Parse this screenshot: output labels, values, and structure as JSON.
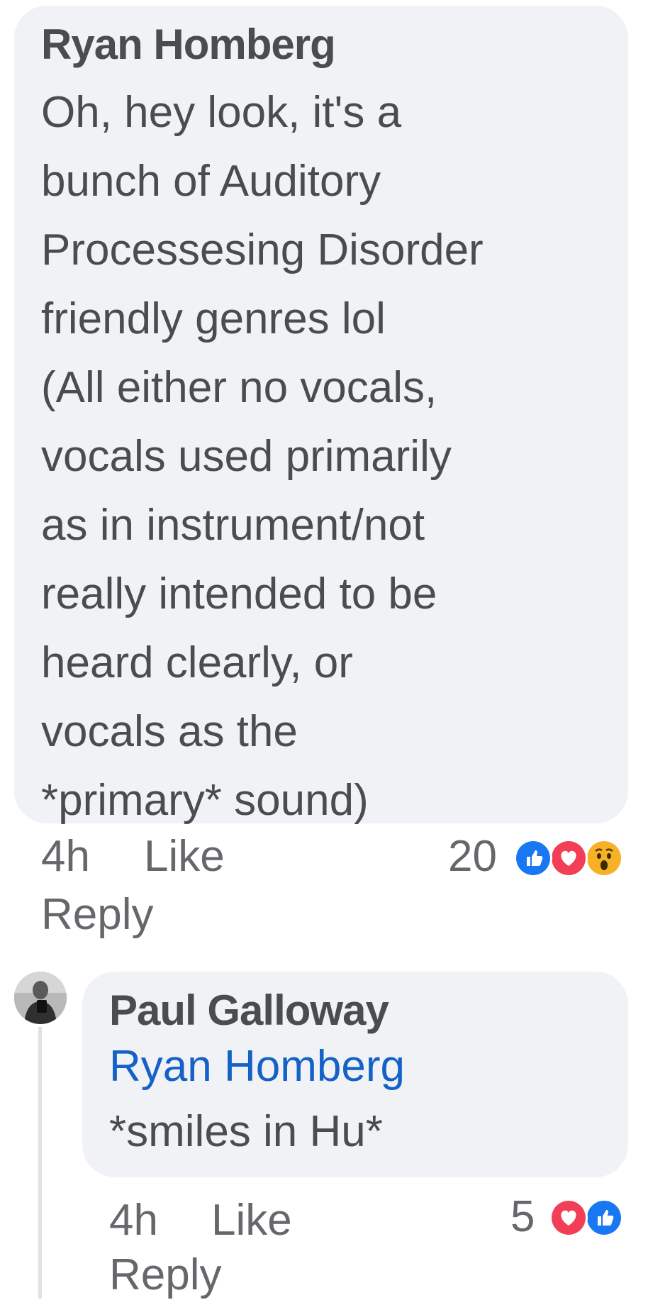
{
  "main_comment": {
    "author": "Ryan Homberg",
    "text": "Oh, hey look, it's a\nbunch of Auditory\nProcessesing Disorder\nfriendly genres lol\n(All either no vocals,\nvocals used primarily\nas in instrument/not\nreally intended to be\nheard clearly, or\nvocals as the\n*primary* sound)",
    "time": "4h",
    "like_label": "Like",
    "reply_label": "Reply",
    "reaction_count": "20",
    "reactions": [
      "like-icon",
      "love-icon",
      "wow-icon"
    ]
  },
  "reply_comment": {
    "author": "Paul Galloway",
    "mention": "Ryan Homberg",
    "text": "*smiles in Hu*",
    "time": "4h",
    "like_label": "Like",
    "reply_label": "Reply",
    "reaction_count": "5",
    "reactions": [
      "love-icon",
      "like-icon"
    ]
  },
  "colors": {
    "bubble": "#f0f2f5",
    "text": "#4b4c4f",
    "meta": "#65676b",
    "mention": "#1461c7",
    "like_blue": "#1877f2",
    "love_red": "#f33e58",
    "wow_yellow": "#f7b125"
  }
}
